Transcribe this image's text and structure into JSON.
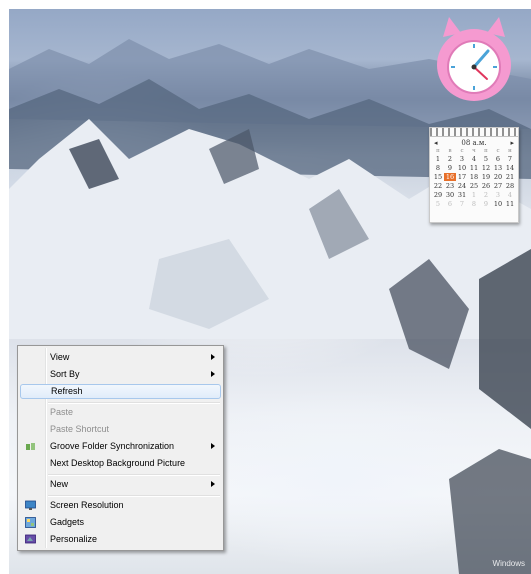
{
  "calendar": {
    "month_label": "08 а.м.",
    "weekdays": [
      "п",
      "в",
      "с",
      "ч",
      "п",
      "с",
      "н"
    ],
    "weeks": [
      [
        "1",
        "2",
        "3",
        "4",
        "5",
        "6",
        "7"
      ],
      [
        "8",
        "9",
        "10",
        "11",
        "12",
        "13",
        "14"
      ],
      [
        "15",
        "16",
        "17",
        "18",
        "19",
        "20",
        "21"
      ],
      [
        "22",
        "23",
        "24",
        "25",
        "26",
        "27",
        "28"
      ],
      [
        "29",
        "30",
        "31",
        "1",
        "2",
        "3",
        "4"
      ],
      [
        "5",
        "6",
        "7",
        "8",
        "9",
        "10",
        "11"
      ]
    ],
    "today": "16",
    "today_color": "#e8702a"
  },
  "context_menu": {
    "items": [
      {
        "label": "View",
        "submenu": true,
        "disabled": false
      },
      {
        "label": "Sort By",
        "submenu": true,
        "disabled": false
      },
      {
        "label": "Refresh",
        "submenu": false,
        "disabled": false,
        "highlighted": true
      },
      {
        "label": "Paste",
        "submenu": false,
        "disabled": true
      },
      {
        "label": "Paste Shortcut",
        "submenu": false,
        "disabled": true
      },
      {
        "label": "Groove Folder Synchronization",
        "submenu": true,
        "disabled": false,
        "icon": "groove-icon"
      },
      {
        "label": "Next Desktop Background Picture",
        "submenu": false,
        "disabled": false
      },
      {
        "label": "New",
        "submenu": true,
        "disabled": false
      },
      {
        "label": "Screen Resolution",
        "submenu": false,
        "disabled": false,
        "icon": "monitor-icon"
      },
      {
        "label": "Gadgets",
        "submenu": false,
        "disabled": false,
        "icon": "gadgets-icon"
      },
      {
        "label": "Personalize",
        "submenu": false,
        "disabled": false,
        "icon": "personalize-icon"
      }
    ]
  },
  "watermark": "Windows"
}
